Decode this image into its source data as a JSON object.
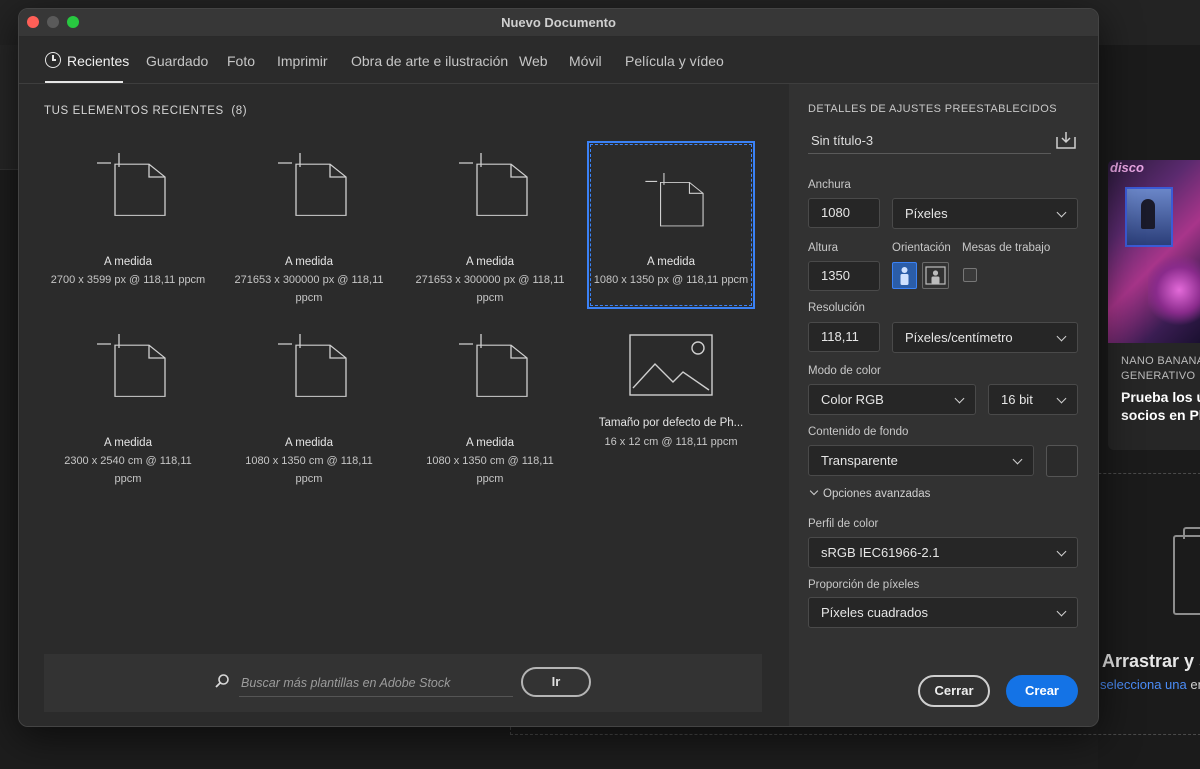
{
  "dialog": {
    "title": "Nuevo Documento",
    "tabs": [
      {
        "label": "Recientes"
      },
      {
        "label": "Guardado"
      },
      {
        "label": "Foto"
      },
      {
        "label": "Imprimir"
      },
      {
        "label": "Obra de arte e ilustración"
      },
      {
        "label": "Web"
      },
      {
        "label": "Móvil"
      },
      {
        "label": "Película y vídeo"
      }
    ],
    "active_tab": "Recientes"
  },
  "recent": {
    "heading": "TUS ELEMENTOS RECIENTES",
    "count": "(8)",
    "items": [
      {
        "name": "A medida",
        "meta": "2700 x 3599 px @ 118,11 ppcm",
        "icon": "document-icon"
      },
      {
        "name": "A medida",
        "meta": "271653 x 300000 px @ 118,11 ppcm",
        "icon": "document-icon"
      },
      {
        "name": "A medida",
        "meta": "271653 x 300000 px @ 118,11 ppcm",
        "icon": "document-icon"
      },
      {
        "name": "A medida",
        "meta": "1080 x 1350 px @ 118,11 ppcm",
        "icon": "document-icon",
        "selected": true
      },
      {
        "name": "A medida",
        "meta": "2300 x 2540 cm @ 118,11 ppcm",
        "icon": "document-icon"
      },
      {
        "name": "A medida",
        "meta": "1080 x 1350 cm @ 118,11 ppcm",
        "icon": "document-icon"
      },
      {
        "name": "A medida",
        "meta": "1080 x 1350 cm @ 118,11 ppcm",
        "icon": "document-icon"
      },
      {
        "name": "Tamaño por defecto de Ph...",
        "meta": "16 x 12 cm @ 118,11 ppcm",
        "icon": "image-icon"
      }
    ]
  },
  "search": {
    "placeholder": "Buscar más plantillas en Adobe Stock",
    "go_label": "Ir"
  },
  "preset": {
    "heading": "DETALLES DE AJUSTES PREESTABLECIDOS",
    "name": "Sin título-3",
    "width_label": "Anchura",
    "width_value": "1080",
    "width_unit": "Píxeles",
    "height_label": "Altura",
    "height_value": "1350",
    "orientation_label": "Orientación",
    "artboards_label": "Mesas de trabajo",
    "resolution_label": "Resolución",
    "resolution_value": "118,11",
    "resolution_unit": "Píxeles/centímetro",
    "color_mode_label": "Modo de color",
    "color_mode": "Color RGB",
    "bit_depth": "16 bit",
    "background_label": "Contenido de fondo",
    "background": "Transparente",
    "advanced_label": "Opciones avanzadas",
    "color_profile_label": "Perfil de color",
    "color_profile": "sRGB IEC61966-2.1",
    "pixel_aspect_label": "Proporción de píxeles",
    "pixel_aspect": "Píxeles cuadrados",
    "close_label": "Cerrar",
    "create_label": "Crear"
  },
  "background_app": {
    "promo_kicker": "NANO BANANA\nGENERATIVO",
    "promo_title": "Prueba los últ\nsocios en Pho",
    "promo_tag": "disco",
    "drop_title": "Arrastrar y s",
    "drop_link": "selecciona una",
    "drop_rest": " en"
  },
  "colors": {
    "accent": "#1473e6",
    "selection": "#3b82f6",
    "dialog_bg": "#2b2b2b",
    "panel_bg": "#323232"
  }
}
